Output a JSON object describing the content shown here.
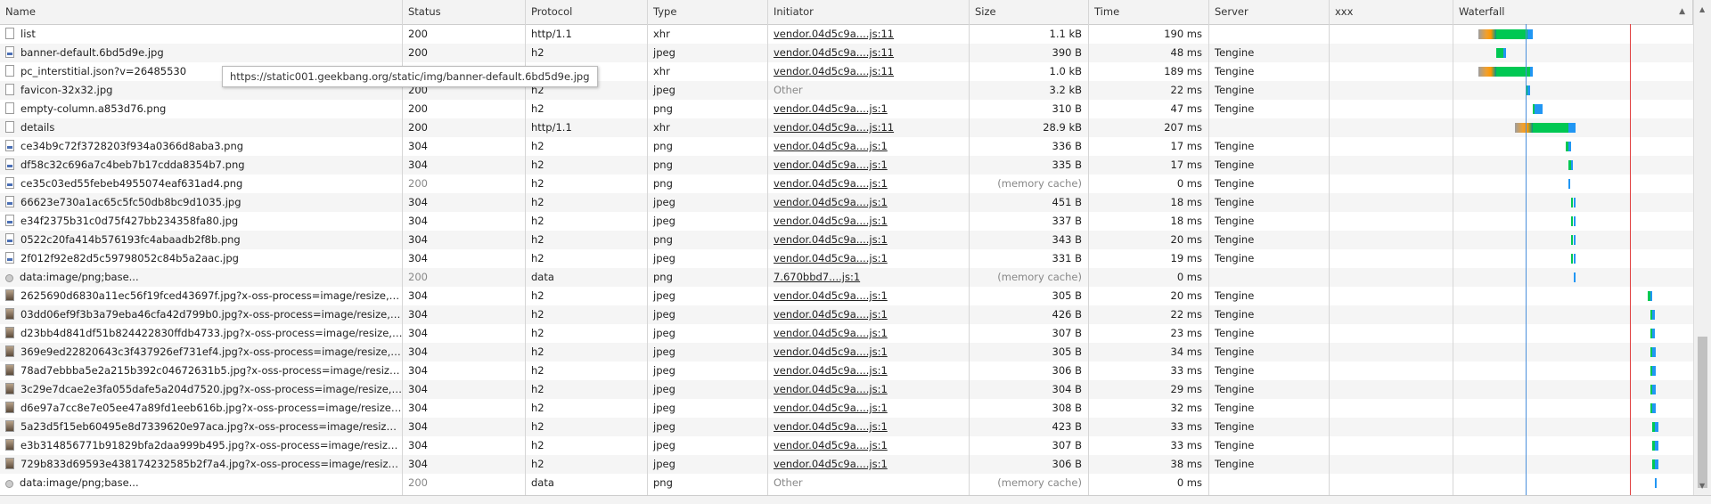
{
  "columns": [
    {
      "label": "Name",
      "sorted": false
    },
    {
      "label": "Status",
      "sorted": false
    },
    {
      "label": "Protocol",
      "sorted": false
    },
    {
      "label": "Type",
      "sorted": false
    },
    {
      "label": "Initiator",
      "sorted": false
    },
    {
      "label": "Size",
      "sorted": false
    },
    {
      "label": "Time",
      "sorted": false
    },
    {
      "label": "Server",
      "sorted": false
    },
    {
      "label": "xxx",
      "sorted": false
    },
    {
      "label": "Waterfall",
      "sorted": true
    }
  ],
  "tooltip": "https://static001.geekbang.org/static/img/banner-default.6bd5d9e.jpg",
  "colors": {
    "queue": "#9e9e9e",
    "stall": "#f0a030",
    "dns": "#009688",
    "connect": "#ff9800",
    "waiting": "#00c853",
    "download": "#2196f3",
    "dom_line": "#4a8fdb",
    "load_line": "#e04040"
  },
  "rows": [
    {
      "name": "list",
      "icon": "doc",
      "status": "200",
      "protocol": "http/1.1",
      "type": "xhr",
      "initiator": "vendor.04d5c9a....js:11",
      "initiator_link": true,
      "size": "1.1 kB",
      "time": "190 ms",
      "server": "",
      "wf_start": 0.18,
      "wf_wait": 0.13,
      "wf_dl": 0.02
    },
    {
      "name": "banner-default.6bd5d9e.jpg",
      "icon": "img",
      "status": "200",
      "protocol": "h2",
      "type": "jpeg",
      "initiator": "vendor.04d5c9a....js:11",
      "initiator_link": true,
      "size": "390 B",
      "time": "48 ms",
      "server": "Tengine",
      "wf_start": 0.18,
      "wf_wait": 0.03,
      "wf_dl": 0.01
    },
    {
      "name": "pc_interstitial.json?v=26485530",
      "icon": "doc",
      "status": "200",
      "protocol": "h2",
      "type": "xhr",
      "initiator": "vendor.04d5c9a....js:11",
      "initiator_link": true,
      "size": "1.0 kB",
      "time": "189 ms",
      "server": "Tengine",
      "wf_start": 0.18,
      "wf_wait": 0.14,
      "wf_dl": 0.01
    },
    {
      "name": "favicon-32x32.jpg",
      "icon": "doc",
      "status": "200",
      "protocol": "h2",
      "type": "jpeg",
      "initiator": "Other",
      "initiator_link": false,
      "size": "3.2 kB",
      "time": "22 ms",
      "server": "Tengine",
      "wf_start": 0.3,
      "wf_wait": 0.01,
      "wf_dl": 0.01
    },
    {
      "name": "empty-column.a853d76.png",
      "icon": "doc",
      "status": "200",
      "protocol": "h2",
      "type": "png",
      "initiator": "vendor.04d5c9a....js:1",
      "initiator_link": true,
      "size": "310 B",
      "time": "47 ms",
      "server": "Tengine",
      "wf_start": 0.33,
      "wf_wait": 0.01,
      "wf_dl": 0.03
    },
    {
      "name": "details",
      "icon": "doc",
      "status": "200",
      "protocol": "http/1.1",
      "type": "xhr",
      "initiator": "vendor.04d5c9a....js:11",
      "initiator_link": true,
      "size": "28.9 kB",
      "time": "207 ms",
      "server": "",
      "wf_start": 0.33,
      "wf_wait": 0.15,
      "wf_dl": 0.03
    },
    {
      "name": "ce34b9c72f3728203f934a0366d8aba3.png",
      "icon": "img",
      "status": "304",
      "protocol": "h2",
      "type": "png",
      "initiator": "vendor.04d5c9a....js:1",
      "initiator_link": true,
      "size": "336 B",
      "time": "17 ms",
      "server": "Tengine",
      "wf_start": 0.47,
      "wf_wait": 0.01,
      "wf_dl": 0.01
    },
    {
      "name": "df58c32c696a7c4beb7b17cdda8354b7.png",
      "icon": "img",
      "status": "304",
      "protocol": "h2",
      "type": "png",
      "initiator": "vendor.04d5c9a....js:1",
      "initiator_link": true,
      "size": "335 B",
      "time": "17 ms",
      "server": "Tengine",
      "wf_start": 0.48,
      "wf_wait": 0.01,
      "wf_dl": 0.01
    },
    {
      "name": "ce35c03ed55febeb4955074eaf631ad4.png",
      "icon": "img",
      "status": "200",
      "status_muted": true,
      "protocol": "h2",
      "type": "png",
      "initiator": "vendor.04d5c9a....js:1",
      "initiator_link": true,
      "size": "(memory cache)",
      "size_muted": true,
      "time": "0 ms",
      "server": "Tengine",
      "wf_start": 0.48,
      "wf_wait": 0,
      "wf_dl": 0.005
    },
    {
      "name": "66623e730a1ac65c5fc50db8bc9d1035.jpg",
      "icon": "img",
      "status": "304",
      "protocol": "h2",
      "type": "jpeg",
      "initiator": "vendor.04d5c9a....js:1",
      "initiator_link": true,
      "size": "451 B",
      "time": "18 ms",
      "server": "Tengine",
      "wf_start": 0.49,
      "wf_wait": 0.01,
      "wf_dl": 0.01
    },
    {
      "name": "e34f2375b31c0d75f427bb234358fa80.jpg",
      "icon": "img",
      "status": "304",
      "protocol": "h2",
      "type": "jpeg",
      "initiator": "vendor.04d5c9a....js:1",
      "initiator_link": true,
      "size": "337 B",
      "time": "18 ms",
      "server": "Tengine",
      "wf_start": 0.49,
      "wf_wait": 0.01,
      "wf_dl": 0.01
    },
    {
      "name": "0522c20fa414b576193fc4abaadb2f8b.png",
      "icon": "img",
      "status": "304",
      "protocol": "h2",
      "type": "png",
      "initiator": "vendor.04d5c9a....js:1",
      "initiator_link": true,
      "size": "343 B",
      "time": "20 ms",
      "server": "Tengine",
      "wf_start": 0.49,
      "wf_wait": 0.01,
      "wf_dl": 0.01
    },
    {
      "name": "2f012f92e82d5c59798052c84b5a2aac.jpg",
      "icon": "img",
      "status": "304",
      "protocol": "h2",
      "type": "jpeg",
      "initiator": "vendor.04d5c9a....js:1",
      "initiator_link": true,
      "size": "331 B",
      "time": "19 ms",
      "server": "Tengine",
      "wf_start": 0.49,
      "wf_wait": 0.01,
      "wf_dl": 0.01
    },
    {
      "name": "data:image/png;base...",
      "icon": "circle",
      "status": "200",
      "status_muted": true,
      "protocol": "data",
      "type": "png",
      "initiator": "7.670bbd7....js:1",
      "initiator_link": true,
      "size": "(memory cache)",
      "size_muted": true,
      "time": "0 ms",
      "server": "",
      "wf_start": 0.5,
      "wf_wait": 0,
      "wf_dl": 0.005
    },
    {
      "name": "2625690d6830a11ec56f19fced43697f.jpg?x-oss-process=image/resize,m_fill,h_...",
      "icon": "pic",
      "status": "304",
      "protocol": "h2",
      "type": "jpeg",
      "initiator": "vendor.04d5c9a....js:1",
      "initiator_link": true,
      "size": "305 B",
      "time": "20 ms",
      "server": "Tengine",
      "wf_start": 0.81,
      "wf_wait": 0.01,
      "wf_dl": 0.01
    },
    {
      "name": "03dd06ef9f3b3a79eba46cfa42d799b0.jpg?x-oss-process=image/resize,m_fill,h...",
      "icon": "pic",
      "status": "304",
      "protocol": "h2",
      "type": "jpeg",
      "initiator": "vendor.04d5c9a....js:1",
      "initiator_link": true,
      "size": "426 B",
      "time": "22 ms",
      "server": "Tengine",
      "wf_start": 0.82,
      "wf_wait": 0.01,
      "wf_dl": 0.01
    },
    {
      "name": "d23bb4d841df51b824422830ffdb4733.jpg?x-oss-process=image/resize,m_fill,...",
      "icon": "pic",
      "status": "304",
      "protocol": "h2",
      "type": "jpeg",
      "initiator": "vendor.04d5c9a....js:1",
      "initiator_link": true,
      "size": "307 B",
      "time": "23 ms",
      "server": "Tengine",
      "wf_start": 0.82,
      "wf_wait": 0.01,
      "wf_dl": 0.01
    },
    {
      "name": "369e9ed22820643c3f437926ef731ef4.jpg?x-oss-process=image/resize,m_fill,h_...",
      "icon": "pic",
      "status": "304",
      "protocol": "h2",
      "type": "jpeg",
      "initiator": "vendor.04d5c9a....js:1",
      "initiator_link": true,
      "size": "305 B",
      "time": "34 ms",
      "server": "Tengine",
      "wf_start": 0.82,
      "wf_wait": 0.01,
      "wf_dl": 0.015
    },
    {
      "name": "78ad7ebbba5e2a215b392c04672631b5.jpg?x-oss-process=image/resize,m_fill,...",
      "icon": "pic",
      "status": "304",
      "protocol": "h2",
      "type": "jpeg",
      "initiator": "vendor.04d5c9a....js:1",
      "initiator_link": true,
      "size": "306 B",
      "time": "33 ms",
      "server": "Tengine",
      "wf_start": 0.82,
      "wf_wait": 0.01,
      "wf_dl": 0.015
    },
    {
      "name": "3c29e7dcae2e3fa055dafe5a204d7520.jpg?x-oss-process=image/resize,m_fill,h...",
      "icon": "pic",
      "status": "304",
      "protocol": "h2",
      "type": "jpeg",
      "initiator": "vendor.04d5c9a....js:1",
      "initiator_link": true,
      "size": "304 B",
      "time": "29 ms",
      "server": "Tengine",
      "wf_start": 0.82,
      "wf_wait": 0.01,
      "wf_dl": 0.015
    },
    {
      "name": "d6e97a7cc8e7e05ee47a89fd1eeb616b.jpg?x-oss-process=image/resize,m_fill,h...",
      "icon": "pic",
      "status": "304",
      "protocol": "h2",
      "type": "jpeg",
      "initiator": "vendor.04d5c9a....js:1",
      "initiator_link": true,
      "size": "308 B",
      "time": "32 ms",
      "server": "Tengine",
      "wf_start": 0.82,
      "wf_wait": 0.01,
      "wf_dl": 0.015
    },
    {
      "name": "5a23d5f15eb60495e8d7339620e97aca.jpg?x-oss-process=image/resize,m_fill,...",
      "icon": "pic",
      "status": "304",
      "protocol": "h2",
      "type": "jpeg",
      "initiator": "vendor.04d5c9a....js:1",
      "initiator_link": true,
      "size": "423 B",
      "time": "33 ms",
      "server": "Tengine",
      "wf_start": 0.83,
      "wf_wait": 0.01,
      "wf_dl": 0.015
    },
    {
      "name": "e3b314856771b91829bfa2daa999b495.jpg?x-oss-process=image/resize,m_fill,...",
      "icon": "pic",
      "status": "304",
      "protocol": "h2",
      "type": "jpeg",
      "initiator": "vendor.04d5c9a....js:1",
      "initiator_link": true,
      "size": "307 B",
      "time": "33 ms",
      "server": "Tengine",
      "wf_start": 0.83,
      "wf_wait": 0.01,
      "wf_dl": 0.015
    },
    {
      "name": "729b833d69593e438174232585b2f7a4.jpg?x-oss-process=image/resize,m_fill,...",
      "icon": "pic",
      "status": "304",
      "protocol": "h2",
      "type": "jpeg",
      "initiator": "vendor.04d5c9a....js:1",
      "initiator_link": true,
      "size": "306 B",
      "time": "38 ms",
      "server": "Tengine",
      "wf_start": 0.83,
      "wf_wait": 0.01,
      "wf_dl": 0.015
    },
    {
      "name": "data:image/png;base...",
      "icon": "circle",
      "status": "200",
      "status_muted": true,
      "protocol": "data",
      "type": "png",
      "initiator": "Other",
      "initiator_link": false,
      "size": "(memory cache)",
      "size_muted": true,
      "time": "0 ms",
      "server": "",
      "wf_start": 0.84,
      "wf_wait": 0,
      "wf_dl": 0.005
    }
  ]
}
